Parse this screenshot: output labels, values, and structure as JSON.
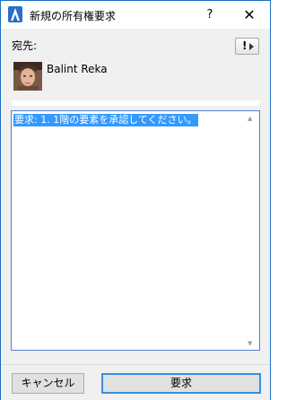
{
  "window": {
    "title": "新規の所有権要求",
    "help_label": "?",
    "close_label": "✕",
    "accent": "#1c6fc4"
  },
  "recipient": {
    "to_label": "宛先:",
    "name": "Balint Reka",
    "options_label": "!"
  },
  "message": {
    "text": "要求: 1. 1階の要素を承認してください。",
    "selection_color": "#3399ff"
  },
  "buttons": {
    "cancel_label": "キャンセル",
    "request_label": "要求"
  }
}
